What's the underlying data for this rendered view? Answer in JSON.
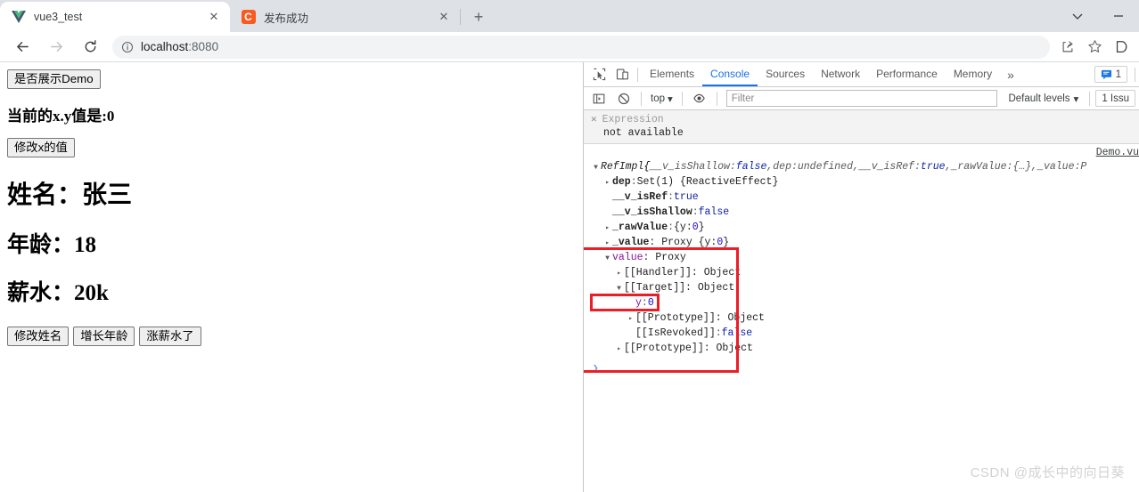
{
  "browser": {
    "tabs": [
      {
        "title": "vue3_test",
        "favicon": "vue-logo-icon",
        "active": true,
        "close_label": "✕"
      },
      {
        "title": "发布成功",
        "favicon": "csdn-c-icon",
        "favicon_text": "C",
        "active": false,
        "close_label": "✕"
      }
    ],
    "new_tab_label": "+",
    "window_controls": {
      "expand_label": "⌄",
      "minimize_label": "─"
    },
    "nav": {
      "back_label": "←",
      "forward_label": "→",
      "reload_label": "⟳"
    },
    "omnibox": {
      "info_icon": "info-circle-icon",
      "host": "localhost",
      "port": ":8080",
      "full_url": "localhost:8080"
    },
    "toolbar_right": {
      "share_icon": "share-icon",
      "bookmark_icon": "star-icon",
      "extra_icon": "d-icon"
    }
  },
  "page": {
    "toggle_demo_button": "是否展示Demo",
    "xy_line": "当前的x.y值是:0",
    "modify_x_button": "修改x的值",
    "fields": [
      {
        "label": "姓名：",
        "value": "张三"
      },
      {
        "label": "年龄：",
        "value": "18"
      },
      {
        "label": "薪水：",
        "value": "20k"
      }
    ],
    "action_buttons": [
      "修改姓名",
      "增长年龄",
      "涨薪水了"
    ]
  },
  "devtools": {
    "inspect_icon": "inspect-element-icon",
    "device_icon": "device-toolbar-icon",
    "tabs": [
      {
        "label": "Elements",
        "selected": false
      },
      {
        "label": "Console",
        "selected": true
      },
      {
        "label": "Sources",
        "selected": false
      },
      {
        "label": "Network",
        "selected": false
      },
      {
        "label": "Performance",
        "selected": false
      },
      {
        "label": "Memory",
        "selected": false
      }
    ],
    "more_tabs_label": "»",
    "messages_badge": {
      "icon": "message-icon",
      "count": "1"
    },
    "filterbar": {
      "sidebar_icon": "console-sidebar-icon",
      "clear_icon": "clear-console-icon",
      "context": "top",
      "context_caret": "▾",
      "eye_icon": "live-expression-icon",
      "filter_placeholder": "Filter",
      "filter_value": "",
      "levels": "Default levels",
      "levels_caret": "▾",
      "issues": "1 Issu"
    },
    "live_expression": {
      "close_label": "✕",
      "name": "Expression",
      "result": "not available"
    },
    "source_link": "Demo.vu",
    "console_lines": [
      {
        "indent": 0,
        "arrow": "▼",
        "segments": [
          {
            "t": "RefImpl ",
            "c": "v-name"
          },
          {
            "t": "{",
            "c": "ital"
          },
          {
            "t": "__v_isShallow: ",
            "c": "ital dim"
          },
          {
            "t": "false",
            "c": "ital v-bool"
          },
          {
            "t": ", ",
            "c": "ital dim"
          },
          {
            "t": "dep: ",
            "c": "ital dim"
          },
          {
            "t": "undefined",
            "c": "ital v-undef"
          },
          {
            "t": ", ",
            "c": "ital dim"
          },
          {
            "t": "__v_isRef: ",
            "c": "ital dim"
          },
          {
            "t": "true",
            "c": "ital v-bool"
          },
          {
            "t": ", ",
            "c": "ital dim"
          },
          {
            "t": "_rawValue: ",
            "c": "ital dim"
          },
          {
            "t": "{…}",
            "c": "ital dim"
          },
          {
            "t": ", ",
            "c": "ital dim"
          },
          {
            "t": "_value: ",
            "c": "ital dim"
          },
          {
            "t": "P",
            "c": "ital dim"
          }
        ]
      },
      {
        "indent": 1,
        "arrow": "▸",
        "segments": [
          {
            "t": "dep",
            "c": "k-own"
          },
          {
            "t": ": ",
            "c": "dim"
          },
          {
            "t": "Set(1) {ReactiveEffect}",
            "c": "v-obj"
          }
        ]
      },
      {
        "indent": 1,
        "arrow": "",
        "segments": [
          {
            "t": "__v_isRef",
            "c": "k-own"
          },
          {
            "t": ": ",
            "c": "dim"
          },
          {
            "t": "true",
            "c": "v-bool"
          }
        ]
      },
      {
        "indent": 1,
        "arrow": "",
        "segments": [
          {
            "t": "__v_isShallow",
            "c": "k-own"
          },
          {
            "t": ": ",
            "c": "dim"
          },
          {
            "t": "false",
            "c": "v-bool"
          }
        ]
      },
      {
        "indent": 1,
        "arrow": "▸",
        "segments": [
          {
            "t": "_rawValue",
            "c": "k-own"
          },
          {
            "t": ": ",
            "c": "dim"
          },
          {
            "t": "{y: ",
            "c": "v-obj"
          },
          {
            "t": "0",
            "c": "v-num"
          },
          {
            "t": "}",
            "c": "v-obj"
          }
        ]
      },
      {
        "indent": 1,
        "arrow": "▸",
        "segments": [
          {
            "t": "_value",
            "c": "k-own"
          },
          {
            "t": ": Proxy {y: ",
            "c": "v-obj"
          },
          {
            "t": "0",
            "c": "v-num"
          },
          {
            "t": "}",
            "c": "v-obj"
          }
        ]
      },
      {
        "indent": 1,
        "arrow": "▼",
        "segments": [
          {
            "t": "value",
            "c": "k-prop"
          },
          {
            "t": ": Proxy",
            "c": "v-obj"
          }
        ]
      },
      {
        "indent": 2,
        "arrow": "▸",
        "segments": [
          {
            "t": "[[Handler]]",
            "c": "v-obj"
          },
          {
            "t": ": Object",
            "c": "v-obj"
          }
        ]
      },
      {
        "indent": 2,
        "arrow": "▼",
        "segments": [
          {
            "t": "[[Target]]",
            "c": "v-obj"
          },
          {
            "t": ": Object",
            "c": "v-obj"
          }
        ]
      },
      {
        "indent": 3,
        "arrow": "",
        "segments": [
          {
            "t": "y",
            "c": "k-prop"
          },
          {
            "t": ": ",
            "c": "dim"
          },
          {
            "t": "0",
            "c": "v-num"
          }
        ]
      },
      {
        "indent": 3,
        "arrow": "▸",
        "segments": [
          {
            "t": "[[Prototype]]",
            "c": "v-obj"
          },
          {
            "t": ": Object",
            "c": "v-obj"
          }
        ]
      },
      {
        "indent": 3,
        "arrow": "",
        "segments": [
          {
            "t": "[[IsRevoked]]",
            "c": "v-obj"
          },
          {
            "t": ": ",
            "c": "dim"
          },
          {
            "t": "false",
            "c": "v-bool"
          }
        ]
      },
      {
        "indent": 2,
        "arrow": "▸",
        "segments": [
          {
            "t": "[[Prototype]]",
            "c": "v-obj"
          },
          {
            "t": ": Object",
            "c": "v-obj"
          }
        ]
      }
    ],
    "prompt_caret": "❯",
    "annotations": {
      "outer_box_color": "#ee1c25",
      "inner_box_color": "#ee1c25"
    }
  },
  "watermark": "CSDN @成长中的向日葵"
}
